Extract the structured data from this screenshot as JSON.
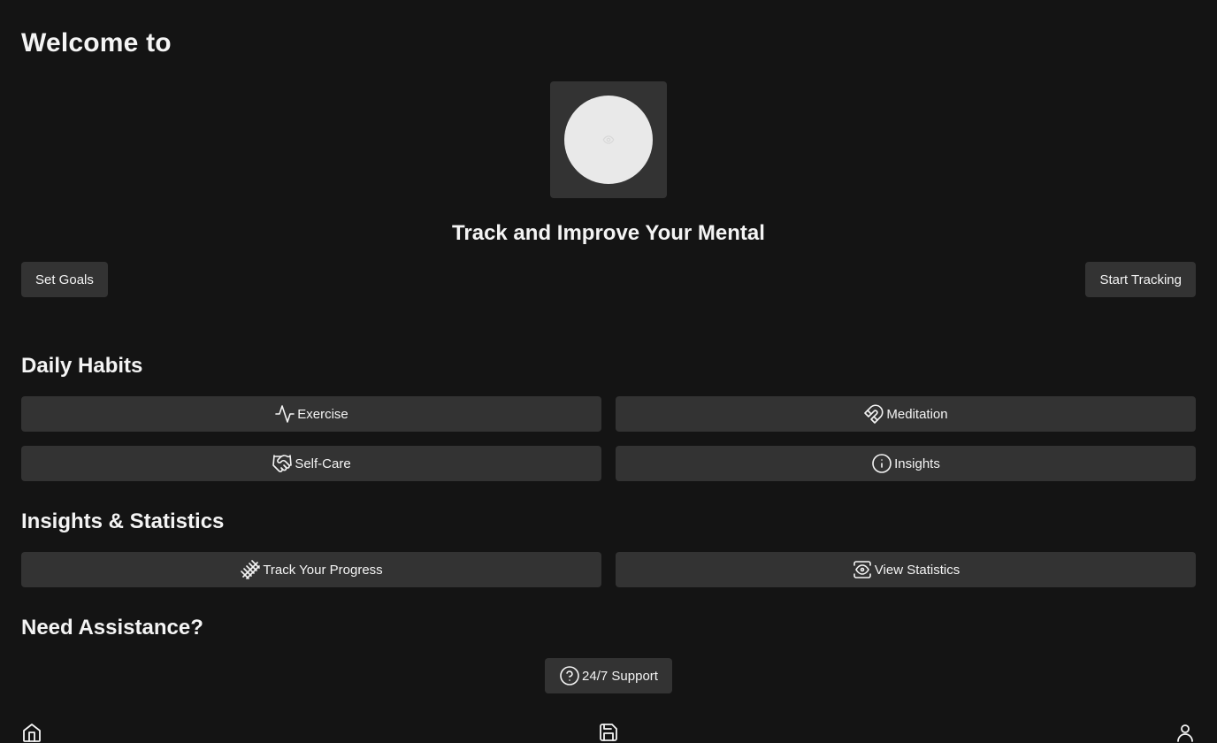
{
  "header": {
    "title": "Welcome to"
  },
  "hero": {
    "icon": "eye-icon",
    "tagline": "Track and Improve Your Mental"
  },
  "actions": {
    "set_goals": "Set Goals",
    "start_tracking": "Start Tracking"
  },
  "daily_habits": {
    "title": "Daily Habits",
    "items": [
      {
        "label": "Exercise",
        "icon": "activity-icon"
      },
      {
        "label": "Meditation",
        "icon": "magnet-icon"
      },
      {
        "label": "Self-Care",
        "icon": "handshake-icon"
      },
      {
        "label": "Insights",
        "icon": "info-icon"
      }
    ]
  },
  "insights": {
    "title": "Insights & Statistics",
    "items": [
      {
        "label": "Track Your Progress",
        "icon": "railway-track-icon"
      },
      {
        "label": "View Statistics",
        "icon": "view-icon"
      }
    ]
  },
  "assistance": {
    "title": "Need Assistance?",
    "support_label": "24/7 Support",
    "icon": "help-circle-icon"
  },
  "bottom_nav": {
    "items": [
      "home-icon",
      "save-icon",
      "user-icon"
    ]
  },
  "colors": {
    "background": "#141414",
    "surface": "#333333",
    "text": "#f4f4f4",
    "hero_circle": "#e9e9e9"
  }
}
